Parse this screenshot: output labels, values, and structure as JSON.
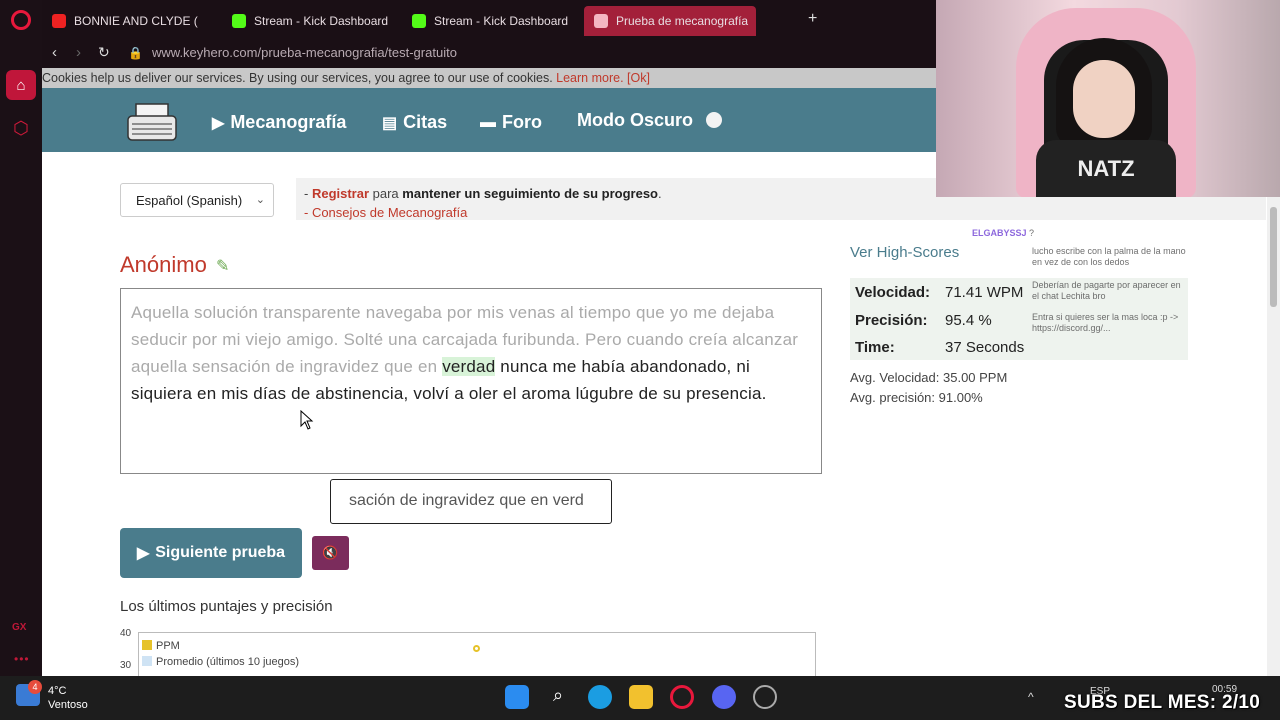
{
  "browser": {
    "tabs": [
      {
        "label": "BONNIE AND CLYDE (",
        "icon": "youtube-icon"
      },
      {
        "label": "Stream - Kick Dashboard",
        "icon": "kick-icon"
      },
      {
        "label": "Stream - Kick Dashboard",
        "icon": "kick-icon"
      },
      {
        "label": "Prueba de mecanografía",
        "icon": "keyhero-icon"
      }
    ],
    "new_tab": "+",
    "url": "www.keyhero.com/prueba-mecanografia/test-gratuito"
  },
  "cookie_bar": {
    "text": "Cookies help us deliver our services. By using our services, you agree to our use of cookies.",
    "learn_more": "Learn more.",
    "ok": "[Ok]"
  },
  "site_nav": {
    "typing": "Mecanografía",
    "quotes": "Citas",
    "forum": "Foro",
    "dark_mode": "Modo Oscuro"
  },
  "language_select": {
    "value": "Español (Spanish)"
  },
  "info": {
    "line1_prefix": "- ",
    "register": "Registrar",
    "line1_mid": " para ",
    "line1_bold": "mantener un seguimiento de su progreso",
    "line1_end": ".",
    "line2": "- Consejos de Mecanografía"
  },
  "user": {
    "name": "Anónimo"
  },
  "test_text": {
    "typed": "Aquella solución transparente navegaba por mis venas al tiempo que yo me dejaba seducir por mi viejo amigo. Solté una carcajada furibunda. Pero cuando creía alcanzar aquella sensación de ingravidez que en ",
    "current": "verdad",
    "rest": " nunca me había abandonado, ni siquiera en mis días de abstinencia, volví a oler el aroma lúgubre de su presencia."
  },
  "input": {
    "value": "sación de ingravidez que en verd"
  },
  "buttons": {
    "next_test": "Siguiente prueba",
    "mute": "🔇"
  },
  "scores": {
    "title": "Los últimos puntajes y precisión",
    "yticks": [
      "40",
      "30"
    ],
    "legend": [
      "PPM",
      "Promedio (últimos 10 juegos)"
    ]
  },
  "results": {
    "high_scores_link": "Ver High-Scores",
    "speed_label": "Velocidad:",
    "speed_value": "71.41 WPM",
    "precision_label": "Precisión:",
    "precision_value": "95.4 %",
    "time_label": "Time:",
    "time_value": "37 Seconds",
    "avg_speed": "Avg. Velocidad: 35.00 PPM",
    "avg_precision": "Avg. precisión: 91.00%"
  },
  "chat": [
    {
      "user": "ELGABYSSJ",
      "msg": "?"
    },
    {
      "user": "",
      "msg": "lucho escribe con la palma de la mano en vez de con los dedos"
    },
    {
      "user": "",
      "msg": "Deberían de pagarte por aparecer en el chat Lechita bro"
    },
    {
      "user": "",
      "msg": "Entra si quieres ser la mas loca :p -> https://discord.gg/..."
    }
  ],
  "webcam": {
    "shirt_text": "NATZ"
  },
  "taskbar": {
    "weather_temp": "4°C",
    "weather_desc": "Ventoso",
    "weather_badge": "4",
    "lang": "ESP",
    "clock": "00:59"
  },
  "overlay": {
    "subs": "SUBS DEL MES: 2/10"
  },
  "colors": {
    "accent": "#4a7c8c",
    "brand_red": "#c0392b",
    "opera_red": "#e8183c"
  }
}
